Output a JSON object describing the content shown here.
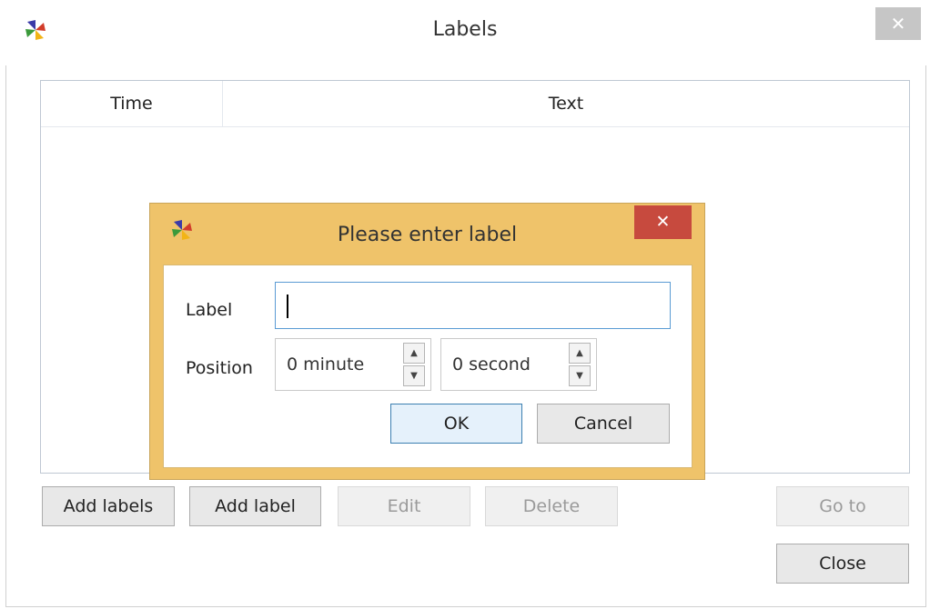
{
  "main_window": {
    "title": "Labels",
    "close_glyph": "✕",
    "icon": "app-pinwheel-icon",
    "table": {
      "columns": [
        "Time",
        "Text"
      ],
      "rows": []
    },
    "buttons": {
      "add_labels": "Add labels",
      "add_label": "Add label",
      "edit": "Edit",
      "delete": "Delete",
      "go_to": "Go to",
      "close": "Close"
    }
  },
  "dialog": {
    "title": "Please enter label",
    "close_glyph": "✕",
    "icon": "app-pinwheel-icon",
    "label_field": {
      "label": "Label",
      "value": ""
    },
    "position": {
      "label": "Position",
      "minute_value": "0 minute",
      "second_value": "0 second"
    },
    "buttons": {
      "ok": "OK",
      "cancel": "Cancel"
    }
  },
  "colors": {
    "dialog_frame": "#efc36a",
    "dialog_close": "#c74a3e",
    "focus_border": "#5a9bd4",
    "main_close": "#c6c6c6"
  }
}
